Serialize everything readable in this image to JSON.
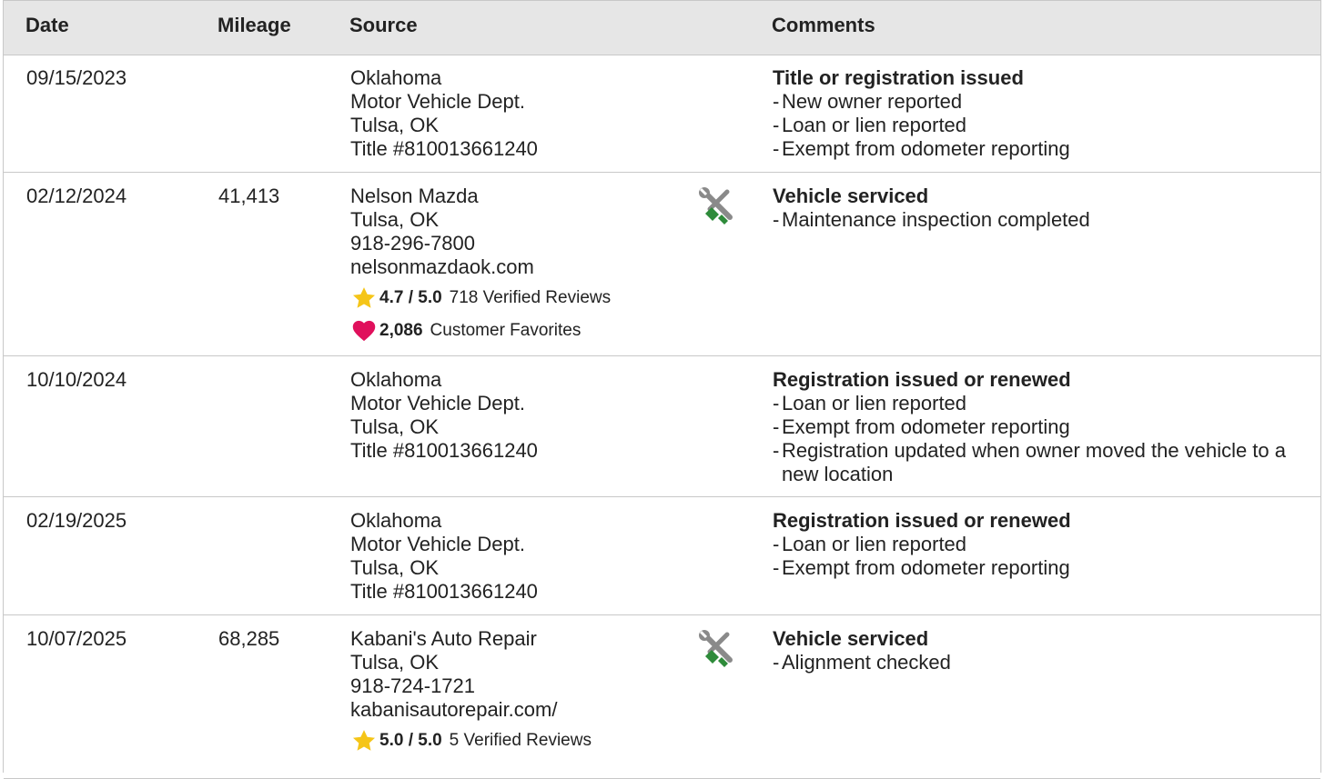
{
  "columns": {
    "date": "Date",
    "mileage": "Mileage",
    "source": "Source",
    "comments": "Comments"
  },
  "rows": [
    {
      "date": "09/15/2023",
      "mileage": "",
      "source_lines": [
        "Oklahoma",
        "Motor Vehicle Dept.",
        "Tulsa, OK",
        "Title #810013661240"
      ],
      "comment_title": "Title or registration issued",
      "comment_items": [
        "New owner reported",
        "Loan or lien reported",
        "Exempt from odometer reporting"
      ]
    },
    {
      "date": "02/12/2024",
      "mileage": "41,413",
      "icon": "wrench-screwdriver-icon",
      "source_lines": [
        "Nelson Mazda",
        "Tulsa, OK",
        "918-296-7800",
        "nelsonmazdaok.com"
      ],
      "rating": {
        "score": "4.7 / 5.0",
        "reviews": "718 Verified Reviews"
      },
      "favorites": {
        "count": "2,086",
        "label": "Customer Favorites"
      },
      "comment_title": "Vehicle serviced",
      "comment_items": [
        "Maintenance inspection completed"
      ]
    },
    {
      "date": "10/10/2024",
      "mileage": "",
      "source_lines": [
        "Oklahoma",
        "Motor Vehicle Dept.",
        "Tulsa, OK",
        "Title #810013661240"
      ],
      "comment_title": "Registration issued or renewed",
      "comment_items": [
        "Loan or lien reported",
        "Exempt from odometer reporting",
        "Registration updated when owner moved the vehicle to a new location"
      ]
    },
    {
      "date": "02/19/2025",
      "mileage": "",
      "source_lines": [
        "Oklahoma",
        "Motor Vehicle Dept.",
        "Tulsa, OK",
        "Title #810013661240"
      ],
      "comment_title": "Registration issued or renewed",
      "comment_items": [
        "Loan or lien reported",
        "Exempt from odometer reporting"
      ]
    },
    {
      "date": "10/07/2025",
      "mileage": "68,285",
      "icon": "wrench-screwdriver-icon",
      "source_lines": [
        "Kabani's Auto Repair",
        "Tulsa, OK",
        "918-724-1721",
        "kabanisautorepair.com/"
      ],
      "rating": {
        "score": "5.0 / 5.0",
        "reviews": "5 Verified Reviews"
      },
      "comment_title": "Vehicle serviced",
      "comment_items": [
        "Alignment checked"
      ]
    }
  ],
  "colors": {
    "header_bg": "#e6e6e6",
    "border": "#c8c8c8",
    "star": "#f5c518",
    "heart": "#e0105c",
    "wrench": "#8a8a8a",
    "screwdriver": "#2e8b3a"
  }
}
